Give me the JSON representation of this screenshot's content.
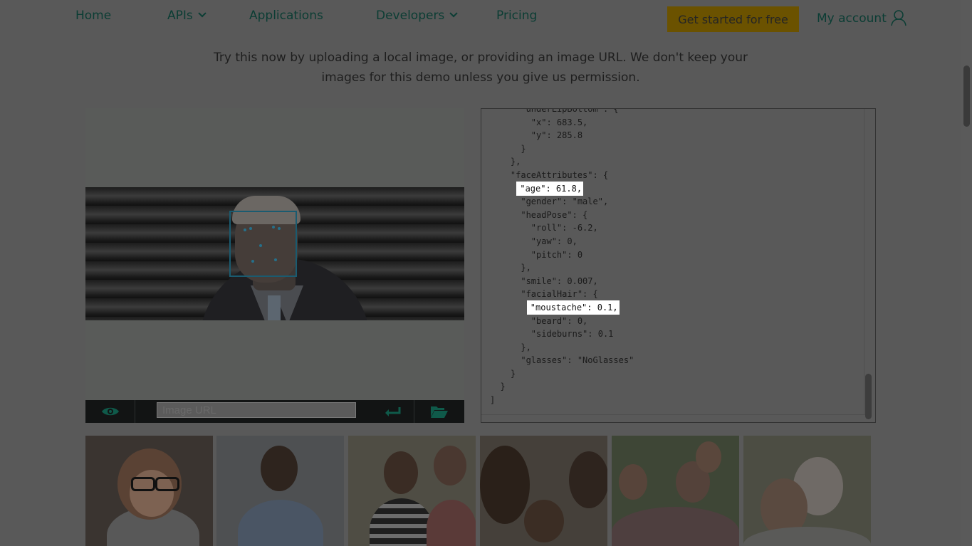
{
  "nav": {
    "items": [
      {
        "label": "Home",
        "dropdown": false
      },
      {
        "label": "APIs",
        "dropdown": true
      },
      {
        "label": "Applications",
        "dropdown": false
      },
      {
        "label": "Developers",
        "dropdown": true
      },
      {
        "label": "Pricing",
        "dropdown": false
      }
    ],
    "cta_label": "Get started for free",
    "account_label": "My account"
  },
  "intro": {
    "line1": "Try this now by uploading a local image, or providing an image URL. We don't keep your",
    "line2": "images for this demo unless you give us permission."
  },
  "image_panel": {
    "url_placeholder": "Image URL",
    "icons": [
      "eye-icon",
      "enter-icon",
      "folder-open-icon"
    ]
  },
  "json_output": {
    "lines": [
      "      \"underLipBottom\": {",
      "        \"x\": 683.5,",
      "        \"y\": 285.8",
      "      }",
      "    },",
      "    \"faceAttributes\": {",
      "      \"age\": 61.8,",
      "      \"gender\": \"male\",",
      "      \"headPose\": {",
      "        \"roll\": -6.2,",
      "        \"yaw\": 0,",
      "        \"pitch\": 0",
      "      },",
      "      \"smile\": 0.007,",
      "      \"facialHair\": {",
      "        \"moustache\": 0.1,",
      "        \"beard\": 0,",
      "        \"sideburns\": 0.1",
      "      },",
      "      \"glasses\": \"NoGlasses\"",
      "    }",
      "  }",
      "]"
    ],
    "highlighted_lines": [
      6,
      15
    ]
  },
  "thumbnails": [
    {
      "name": "thumb-woman-glasses"
    },
    {
      "name": "thumb-man-smiling"
    },
    {
      "name": "thumb-couple"
    },
    {
      "name": "thumb-family-baby"
    },
    {
      "name": "thumb-family-kids"
    },
    {
      "name": "thumb-senior-couple"
    }
  ],
  "colors": {
    "overlay_bg": "#595959",
    "nav_text": "#0b3d34",
    "cta_bg": "#6b5200",
    "face_box": "#1a5b70",
    "toolbar_icon": "#0f5a4a"
  }
}
